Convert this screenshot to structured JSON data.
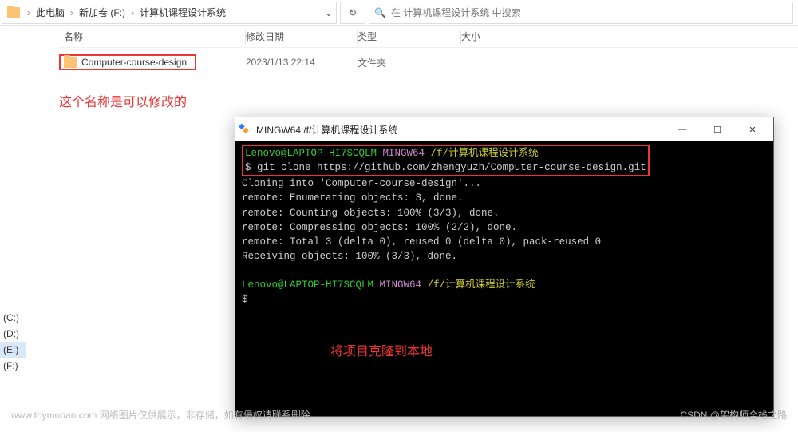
{
  "breadcrumb": {
    "this_pc": "此电脑",
    "drive": "新加卷 (F:)",
    "folder": "计算机课程设计系统"
  },
  "toolbar": {
    "dropdown_glyph": "⌄",
    "refresh_glyph": "↻",
    "search_placeholder": "在 计算机课程设计系统 中搜索",
    "search_glyph": "🔍"
  },
  "columns": {
    "name": "名称",
    "date": "修改日期",
    "type": "类型",
    "size": "大小"
  },
  "files": [
    {
      "name": "Computer-course-design",
      "date": "2023/1/13 22:14",
      "type": "文件夹"
    }
  ],
  "annotations": {
    "rename_note": "这个名称是可以修改的",
    "clone_note": "将项目克隆到本地"
  },
  "drives": [
    {
      "label": "(C:)"
    },
    {
      "label": "(D:)"
    },
    {
      "label": "(E:)",
      "selected": true
    },
    {
      "label": "(F:)"
    }
  ],
  "terminal": {
    "title": "MINGW64:/f/计算机课程设计系统",
    "win_btns": {
      "min": "—",
      "max": "☐",
      "close": "✕"
    },
    "prompt": {
      "user": "Lenovo@LAPTOP-HI7SCQLM",
      "env": "MINGW64",
      "path": "/f/计算机课程设计系统",
      "dollar": "$"
    },
    "command": "git clone https://github.com/zhengyuzh/Computer-course-design.git",
    "output": [
      "Cloning into 'Computer-course-design'...",
      "remote: Enumerating objects: 3, done.",
      "remote: Counting objects: 100% (3/3), done.",
      "remote: Compressing objects: 100% (2/2), done.",
      "remote: Total 3 (delta 0), reused 0 (delta 0), pack-reused 0",
      "Receiving objects: 100% (3/3), done."
    ]
  },
  "watermark": {
    "left": "www.toymoban.com  网络图片仅供展示，非存储，如有侵权请联系删除",
    "right": "CSDN @架构师全栈之路"
  }
}
